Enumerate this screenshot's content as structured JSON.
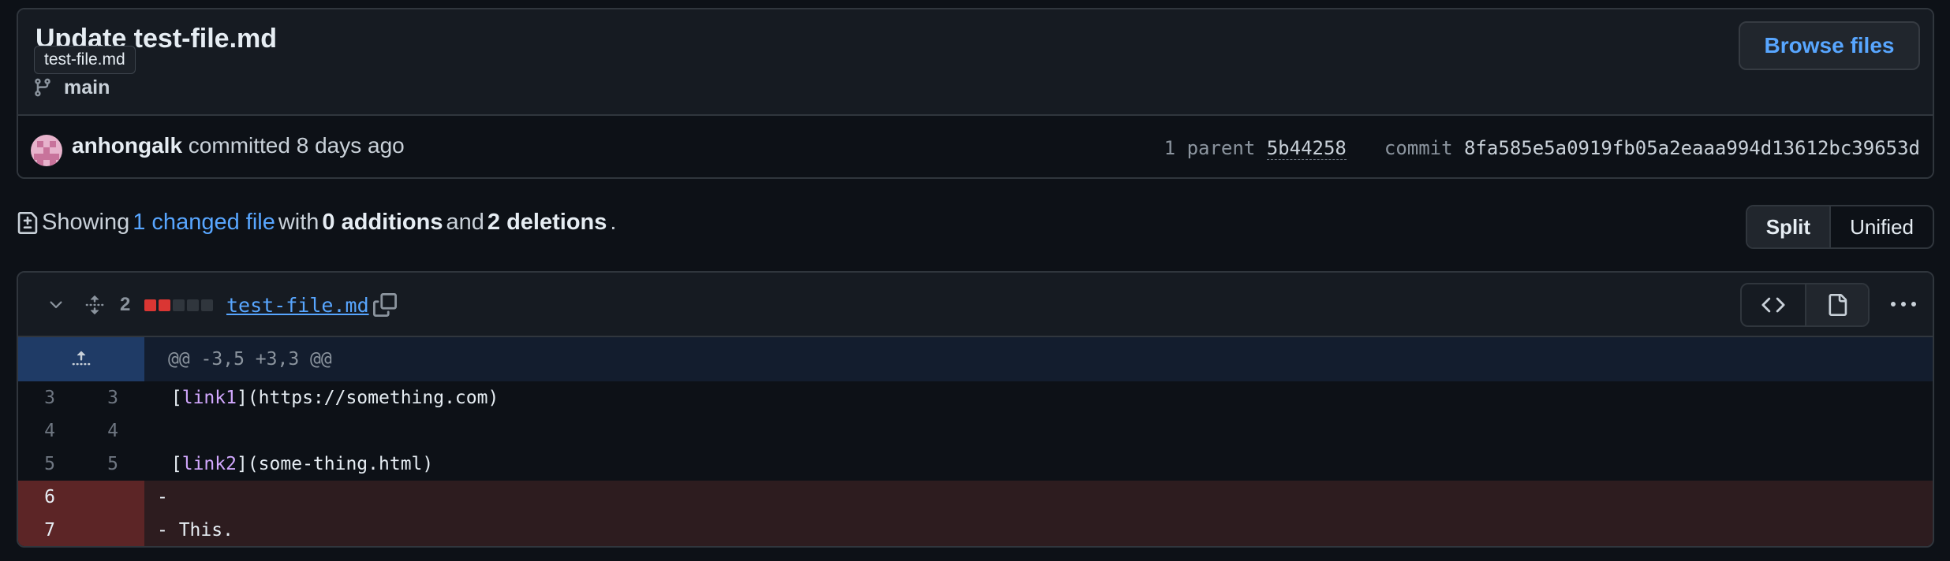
{
  "commit": {
    "title": "Update test-file.md",
    "tooltip": "test-file.md",
    "branch": "main",
    "browse_label": "Browse files",
    "author": "anhongalk",
    "committed_text": "committed 8 days ago",
    "parent_label": "1 parent",
    "parent_sha": "5b44258",
    "commit_label": "commit",
    "commit_sha": "8fa585e5a0919fb05a2eaaa994d13612bc39653d"
  },
  "summary": {
    "showing": "Showing",
    "changed_files": "1 changed file",
    "with": "with",
    "additions": "0 additions",
    "and": "and",
    "deletions": "2 deletions",
    "period": "."
  },
  "view_toggle": {
    "split": "Split",
    "unified": "Unified"
  },
  "file": {
    "deletion_count": "2",
    "name": "test-file.md",
    "hunk_header": "@@ -3,5 +3,3 @@",
    "lines": [
      {
        "old": "3",
        "new": "3",
        "prefix": " ",
        "link": "link1",
        "rest": "(https://something.com)"
      },
      {
        "old": "4",
        "new": "4",
        "text": ""
      },
      {
        "old": "5",
        "new": "5",
        "prefix": " ",
        "link": "link2",
        "rest": "(some-thing.html)"
      },
      {
        "old": "6",
        "new": "",
        "text": "-"
      },
      {
        "old": "7",
        "new": "",
        "text": "- This."
      }
    ]
  },
  "colors": {
    "accent": "#58a6ff",
    "deleted_bg": "#2d1c1f",
    "deleted_gutter": "#5c2526",
    "hunk_bg": "#131d2e"
  }
}
